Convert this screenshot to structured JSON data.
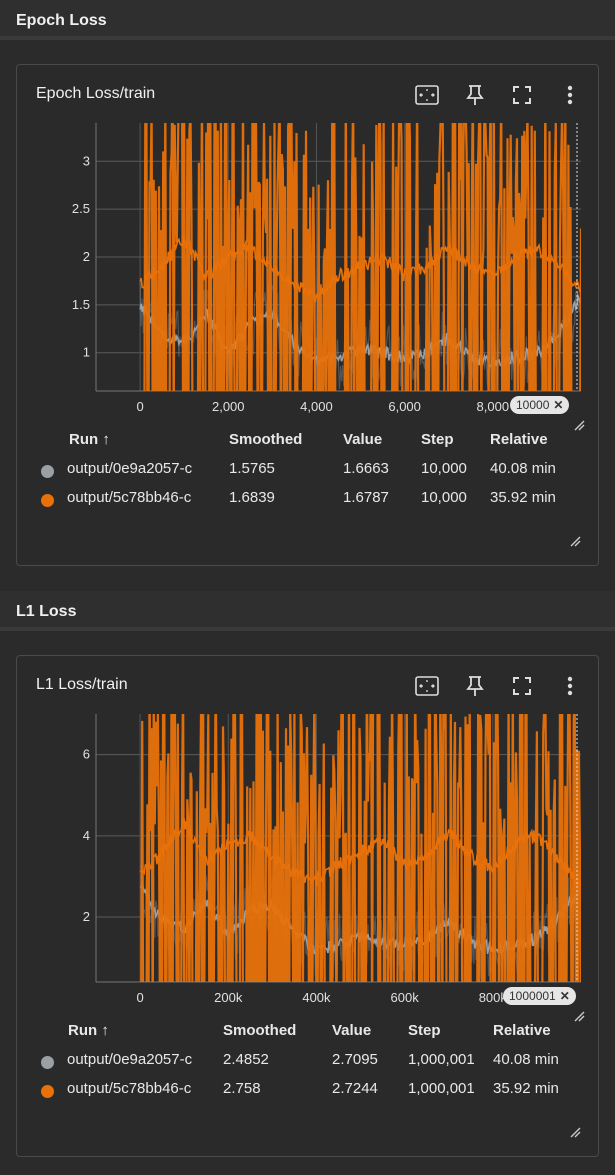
{
  "sections": [
    {
      "title": "Epoch Loss",
      "card_title": "Epoch Loss/train",
      "step_badge": "10000",
      "legend": {
        "headers": {
          "run": "Run ↑",
          "smoothed": "Smoothed",
          "value": "Value",
          "step": "Step",
          "relative": "Relative"
        },
        "rows": [
          {
            "color": "#9aa0a6",
            "run": "output/0e9a2057-c",
            "smoothed": "1.5765",
            "value": "1.6663",
            "step": "10,000",
            "relative": "40.08 min"
          },
          {
            "color": "#e8710a",
            "run": "output/5c78bb46-c",
            "smoothed": "1.6839",
            "value": "1.6787",
            "step": "10,000",
            "relative": "35.92 min"
          }
        ]
      }
    },
    {
      "title": "L1 Loss",
      "card_title": "L1 Loss/train",
      "step_badge": "1000001",
      "legend": {
        "headers": {
          "run": "Run ↑",
          "smoothed": "Smoothed",
          "value": "Value",
          "step": "Step",
          "relative": "Relative"
        },
        "rows": [
          {
            "color": "#9aa0a6",
            "run": "output/0e9a2057-c",
            "smoothed": "2.4852",
            "value": "2.7095",
            "step": "1,000,001",
            "relative": "40.08 min"
          },
          {
            "color": "#e8710a",
            "run": "output/5c78bb46-c",
            "smoothed": "2.758",
            "value": "2.7244",
            "step": "1,000,001",
            "relative": "35.92 min"
          }
        ]
      }
    }
  ],
  "chart_data": [
    {
      "type": "line",
      "title": "Epoch Loss/train",
      "xlabel": "",
      "ylabel": "",
      "xlim": [
        -1000,
        10000
      ],
      "ylim": [
        0.6,
        3.4
      ],
      "x_ticks": [
        "0",
        "2,000",
        "4,000",
        "6,000",
        "8,000"
      ],
      "x_tick_values": [
        0,
        2000,
        4000,
        6000,
        8000
      ],
      "y_ticks": [
        "1",
        "1.5",
        "2",
        "2.5",
        "3"
      ],
      "y_tick_values": [
        1,
        1.5,
        2,
        2.5,
        3
      ],
      "grid": true,
      "series": [
        {
          "name": "output/0e9a2057-c",
          "color": "#9aa0a6",
          "x": [
            0,
            500,
            1000,
            1500,
            2000,
            2500,
            3000,
            3500,
            4000,
            4500,
            5000,
            5500,
            6000,
            6500,
            7000,
            7500,
            8000,
            8500,
            9000,
            9500,
            10000
          ],
          "y": [
            1.5,
            1.2,
            1.1,
            1.4,
            1.0,
            1.3,
            1.4,
            1.1,
            0.9,
            0.95,
            1.05,
            1.0,
            0.95,
            1.0,
            1.15,
            0.95,
            0.9,
            0.95,
            1.0,
            1.2,
            1.6
          ]
        },
        {
          "name": "output/5c78bb46-c",
          "color": "#e8710a",
          "x": [
            0,
            500,
            1000,
            1500,
            2000,
            2500,
            3000,
            3500,
            4000,
            4500,
            5000,
            5500,
            6000,
            6500,
            7000,
            7500,
            8000,
            8500,
            9000,
            9500,
            10000
          ],
          "y": [
            1.7,
            1.9,
            2.2,
            1.8,
            2.0,
            2.1,
            1.9,
            1.7,
            1.6,
            1.8,
            1.9,
            2.0,
            1.8,
            1.9,
            2.1,
            1.9,
            1.8,
            2.0,
            2.1,
            1.9,
            1.68
          ]
        }
      ]
    },
    {
      "type": "line",
      "title": "L1 Loss/train",
      "xlabel": "",
      "ylabel": "",
      "xlim": [
        -100000,
        1000001
      ],
      "ylim": [
        0.4,
        7.0
      ],
      "x_ticks": [
        "0",
        "200k",
        "400k",
        "600k",
        "800k"
      ],
      "x_tick_values": [
        0,
        200000,
        400000,
        600000,
        800000
      ],
      "y_ticks": [
        "2",
        "4",
        "6"
      ],
      "y_tick_values": [
        2,
        4,
        6
      ],
      "grid": true,
      "series": [
        {
          "name": "output/0e9a2057-c",
          "color": "#9aa0a6",
          "x": [
            0,
            50000,
            100000,
            150000,
            200000,
            250000,
            300000,
            350000,
            400000,
            450000,
            500000,
            550000,
            600000,
            650000,
            700000,
            750000,
            800000,
            850000,
            900000,
            950000,
            1000001
          ],
          "y": [
            2.8,
            1.9,
            1.7,
            2.4,
            1.5,
            2.2,
            2.3,
            1.6,
            1.2,
            1.3,
            1.5,
            1.4,
            1.3,
            1.4,
            1.9,
            1.4,
            1.2,
            1.3,
            1.5,
            2.0,
            2.7
          ]
        },
        {
          "name": "output/5c78bb46-c",
          "color": "#e8710a",
          "x": [
            0,
            50000,
            100000,
            150000,
            200000,
            250000,
            300000,
            350000,
            400000,
            450000,
            500000,
            550000,
            600000,
            650000,
            700000,
            750000,
            800000,
            850000,
            900000,
            950000,
            1000001
          ],
          "y": [
            3.0,
            3.6,
            4.3,
            3.4,
            3.8,
            4.0,
            3.5,
            3.1,
            2.9,
            3.3,
            3.6,
            3.9,
            3.3,
            3.5,
            4.1,
            3.5,
            3.2,
            3.8,
            4.0,
            3.4,
            2.72
          ]
        }
      ]
    }
  ]
}
